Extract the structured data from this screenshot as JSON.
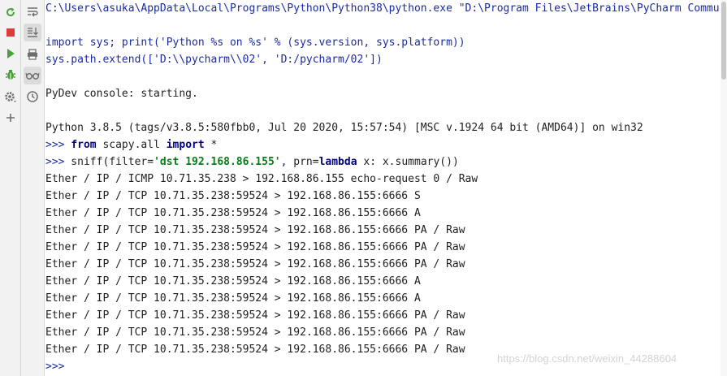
{
  "console": {
    "command_line": "C:\\Users\\asuka\\AppData\\Local\\Programs\\Python\\Python38\\python.exe \"D:\\Program Files\\JetBrains\\PyCharm Commu",
    "startup_line_1": "import sys; print('Python %s on %s' % (sys.version, sys.platform))",
    "startup_line_2": "sys.path.extend(['D:\\\\pycharm\\\\02', 'D:/pycharm/02'])",
    "pydev_status": "PyDev console: starting.",
    "python_version_line": "Python 3.8.5 (tags/v3.8.5:580fbb0, Jul 20 2020, 15:57:54) [MSC v.1924 64 bit (AMD64)] on win32",
    "prompt": ">>>",
    "input_1": {
      "kw_from": "from",
      "module": " scapy.all ",
      "kw_import": "import",
      "rest": " *"
    },
    "input_2": {
      "pre": " sniff(filter=",
      "filter_str": "'dst 192.168.86.155'",
      "mid": ", prn=",
      "kw_lambda": "lambda",
      "post": " x: x.summary())"
    },
    "output_lines": [
      "Ether / IP / ICMP 10.71.35.238 > 192.168.86.155 echo-request 0 / Raw",
      "Ether / IP / TCP 10.71.35.238:59524 > 192.168.86.155:6666 S",
      "Ether / IP / TCP 10.71.35.238:59524 > 192.168.86.155:6666 A",
      "Ether / IP / TCP 10.71.35.238:59524 > 192.168.86.155:6666 PA / Raw",
      "Ether / IP / TCP 10.71.35.238:59524 > 192.168.86.155:6666 PA / Raw",
      "Ether / IP / TCP 10.71.35.238:59524 > 192.168.86.155:6666 PA / Raw",
      "Ether / IP / TCP 10.71.35.238:59524 > 192.168.86.155:6666 A",
      "Ether / IP / TCP 10.71.35.238:59524 > 192.168.86.155:6666 A",
      "Ether / IP / TCP 10.71.35.238:59524 > 192.168.86.155:6666 PA / Raw",
      "Ether / IP / TCP 10.71.35.238:59524 > 192.168.86.155:6666 PA / Raw",
      "Ether / IP / TCP 10.71.35.238:59524 > 192.168.86.155:6666 PA / Raw"
    ],
    "final_prompt": ">>>"
  },
  "watermark": "https://blog.csdn.net/weixin_44288604",
  "left_toolbar": [
    "rerun-icon",
    "stop-icon",
    "run-icon",
    "debug-icon",
    "settings-icon",
    "add-icon"
  ],
  "console_toolbar": [
    "soft-wrap-icon",
    "scroll-to-end-icon",
    "print-icon",
    "show-variables-icon",
    "history-icon"
  ],
  "colors": {
    "prompt": "#1a2ba3",
    "keyword": "#000080",
    "string": "#067d17",
    "stop": "#db3c3c",
    "run": "#4aa33a"
  }
}
